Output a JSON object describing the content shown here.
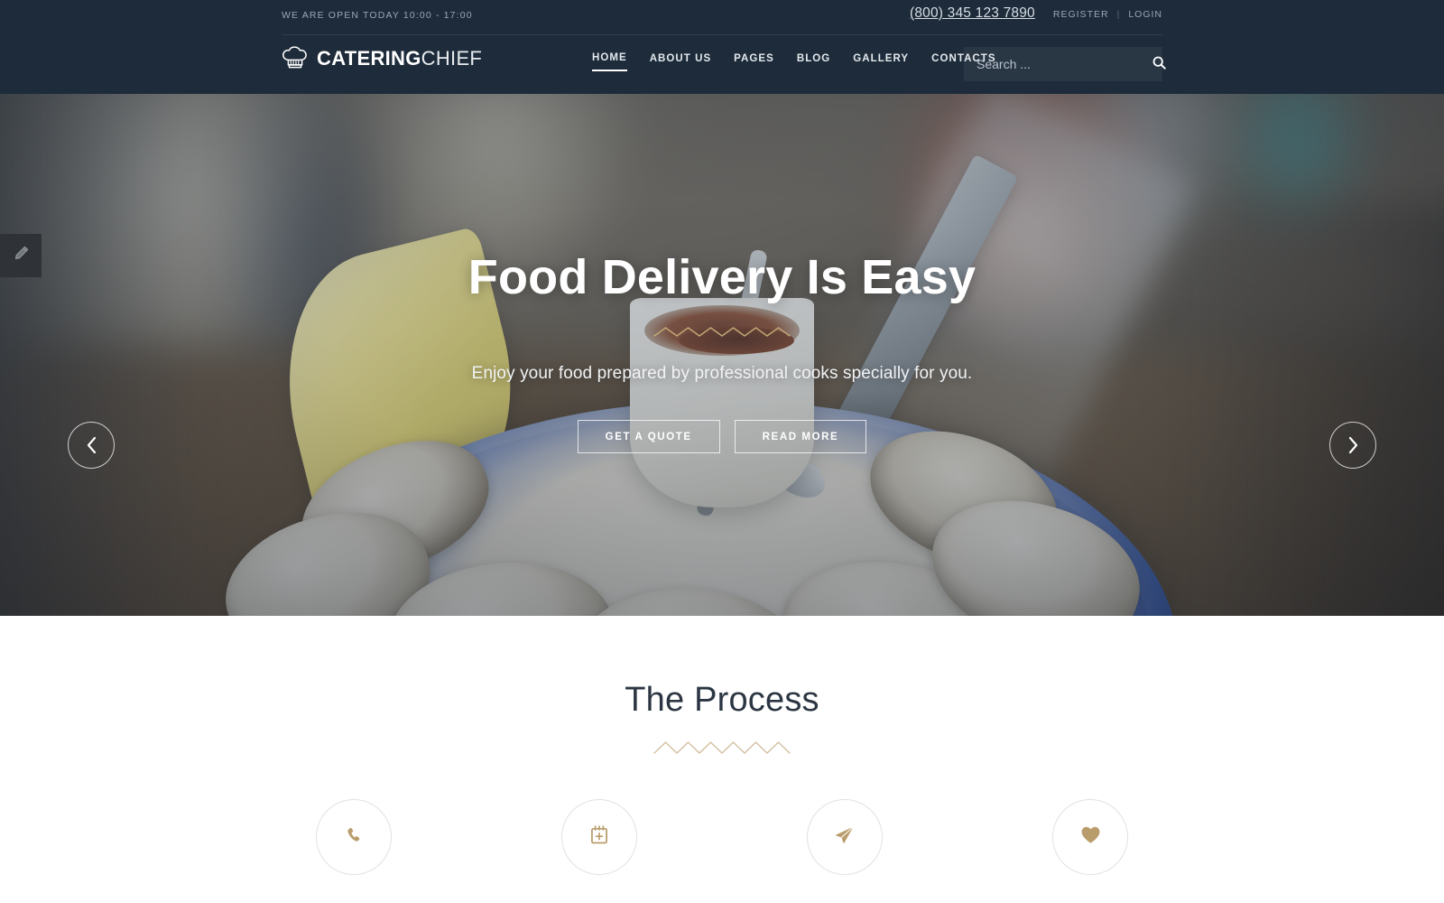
{
  "header": {
    "open_hours": "WE ARE OPEN TODAY 10:00 - 17:00",
    "phone": "(800) 345 123 7890",
    "register_label": "REGISTER",
    "separator": "|",
    "login_label": "LOGIN",
    "logo": {
      "bold_part": "CATERING",
      "light_part": "CHIEF",
      "icon": "chef-hat-icon"
    },
    "nav": [
      {
        "label": "HOME",
        "active": true
      },
      {
        "label": "ABOUT US",
        "active": false
      },
      {
        "label": "PAGES",
        "active": false
      },
      {
        "label": "BLOG",
        "active": false
      },
      {
        "label": "GALLERY",
        "active": false
      },
      {
        "label": "CONTACTS",
        "active": false
      }
    ],
    "search": {
      "placeholder": "Search ...",
      "value": "",
      "icon": "search-icon"
    },
    "colors": {
      "background": "#1d2b3a",
      "text": "#e4e9ee",
      "muted": "#9aa7b4"
    }
  },
  "hero": {
    "title": "Food Delivery Is Easy",
    "subtitle": "Enjoy your food prepared by professional cooks specially for you.",
    "buttons": [
      {
        "label": "GET A QUOTE",
        "name": "get-a-quote-button"
      },
      {
        "label": "READ MORE",
        "name": "read-more-button"
      }
    ],
    "prev_icon": "chevron-left-icon",
    "next_icon": "chevron-right-icon",
    "divider_icon": "zigzag-divider",
    "accent_color": "#c3a875"
  },
  "edit_tab": {
    "icon": "pencil-icon"
  },
  "process": {
    "title": "The Process",
    "divider_icon": "zigzag-divider",
    "items": [
      {
        "icon": "phone-icon"
      },
      {
        "icon": "calendar-plus-icon"
      },
      {
        "icon": "paper-plane-icon"
      },
      {
        "icon": "heart-icon"
      }
    ],
    "icon_color": "#b99c6b",
    "circle_border_color": "#e3e1dd"
  }
}
